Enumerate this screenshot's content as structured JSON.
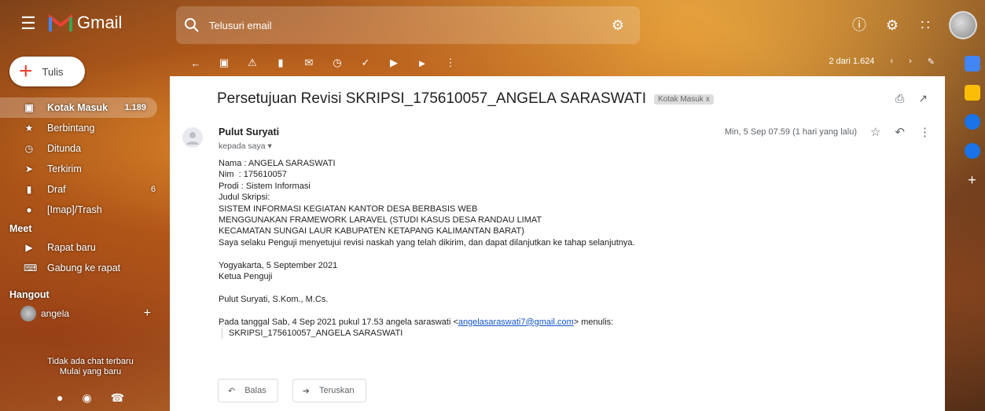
{
  "app": {
    "name": "Gmail"
  },
  "search": {
    "placeholder": "Telusuri email"
  },
  "compose": {
    "label": "Tulis"
  },
  "sidebar": {
    "items": [
      {
        "label": "Kotak Masuk",
        "count": "1.189",
        "icon": "inbox-icon"
      },
      {
        "label": "Berbintang",
        "count": "",
        "icon": "star-icon"
      },
      {
        "label": "Ditunda",
        "count": "",
        "icon": "clock-icon"
      },
      {
        "label": "Terkirim",
        "count": "",
        "icon": "send-icon"
      },
      {
        "label": "Draf",
        "count": "6",
        "icon": "draft-icon"
      },
      {
        "label": "[Imap]/Trash",
        "count": "",
        "icon": "label-icon"
      }
    ],
    "meet": {
      "title": "Meet",
      "items": [
        {
          "label": "Rapat baru",
          "icon": "video-icon"
        },
        {
          "label": "Gabung ke rapat",
          "icon": "keyboard-icon"
        }
      ]
    },
    "hangout": {
      "title": "Hangout",
      "user": "angela",
      "no_chat": "Tidak ada chat terbaru",
      "start_new": "Mulai yang baru"
    }
  },
  "pager": {
    "text": "2 dari 1.624"
  },
  "email": {
    "subject": "Persetujuan Revisi SKRIPSI_175610057_ANGELA SARASWATI",
    "label_chip": "Kotak Masuk",
    "sender": "Pulut Suryati",
    "to": "kepada saya",
    "date": "Min, 5 Sep 07.59 (1 hari yang lalu)",
    "body_lines": [
      "Nama : ANGELA SARASWATI",
      "Nim  : 175610057",
      "Prodi : Sistem Informasi",
      "Judul Skripsi:",
      "SISTEM INFORMASI KEGIATAN KANTOR DESA BERBASIS WEB",
      "MENGGUNAKAN FRAMEWORK LARAVEL (STUDI KASUS DESA RANDAU LIMAT",
      "KECAMATAN SUNGAI LAUR KABUPATEN KETAPANG KALIMANTAN BARAT)",
      "Saya selaku Penguji menyetujui revisi naskah yang telah dikirim, dan dapat dilanjutkan ke tahap selanjutnya."
    ],
    "place_date": "Yogyakarta, 5 September 2021",
    "role": "Ketua Penguji",
    "signature": "Pulut Suryati, S.Kom., M.Cs.",
    "quote_intro": "Pada tanggal Sab, 4 Sep 2021 pukul 17.53 angela saraswati <",
    "quote_email": "angelasaraswati7@gmail.com",
    "quote_end": "> menulis:",
    "quote_text": "SKRIPSI_175610057_ANGELA SARASWATI"
  },
  "actions": {
    "reply": "Balas",
    "forward": "Teruskan"
  }
}
